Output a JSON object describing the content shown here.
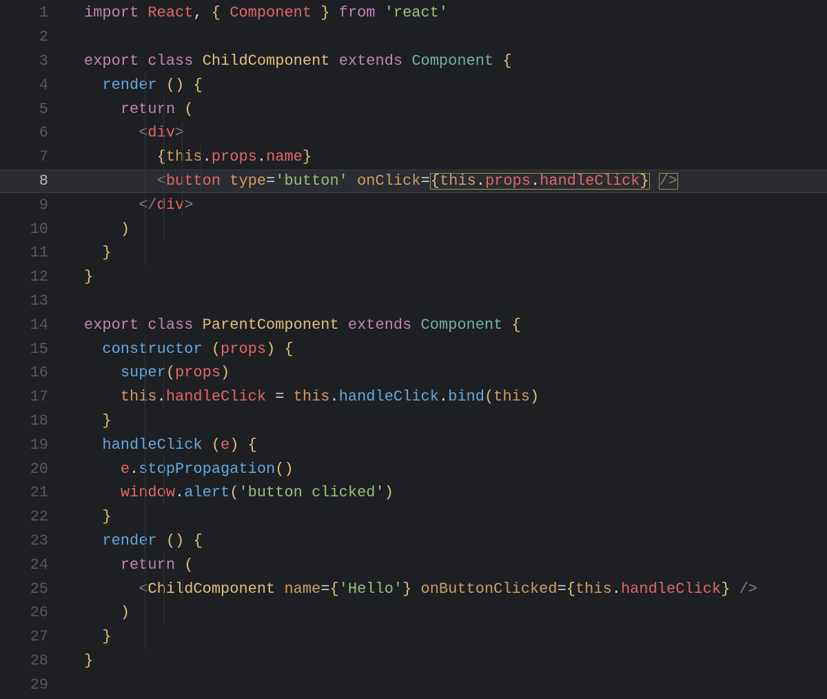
{
  "editor": {
    "highlighted_line": 8,
    "lines": [
      {
        "num": 1,
        "guides": 0,
        "indent": 0,
        "tokens": [
          {
            "c": "kw",
            "t": "import"
          },
          {
            "c": "white",
            "t": " "
          },
          {
            "c": "prop",
            "t": "React"
          },
          {
            "c": "white",
            "t": ", "
          },
          {
            "c": "brace",
            "t": "{"
          },
          {
            "c": "white",
            "t": " "
          },
          {
            "c": "prop",
            "t": "Component"
          },
          {
            "c": "white",
            "t": " "
          },
          {
            "c": "brace",
            "t": "}"
          },
          {
            "c": "white",
            "t": " "
          },
          {
            "c": "kw",
            "t": "from"
          },
          {
            "c": "white",
            "t": " "
          },
          {
            "c": "str",
            "t": "'react'"
          }
        ]
      },
      {
        "num": 2,
        "guides": 0,
        "indent": 0,
        "tokens": []
      },
      {
        "num": 3,
        "guides": 0,
        "indent": 0,
        "tokens": [
          {
            "c": "kw",
            "t": "export"
          },
          {
            "c": "white",
            "t": " "
          },
          {
            "c": "kw",
            "t": "class"
          },
          {
            "c": "white",
            "t": " "
          },
          {
            "c": "cls",
            "t": "ChildComponent"
          },
          {
            "c": "white",
            "t": " "
          },
          {
            "c": "kw",
            "t": "extends"
          },
          {
            "c": "white",
            "t": " "
          },
          {
            "c": "cmp",
            "t": "Component"
          },
          {
            "c": "white",
            "t": " "
          },
          {
            "c": "brace",
            "t": "{"
          }
        ]
      },
      {
        "num": 4,
        "guides": 1,
        "indent": 1,
        "tokens": [
          {
            "c": "mblue",
            "t": "render"
          },
          {
            "c": "white",
            "t": " "
          },
          {
            "c": "brace",
            "t": "()"
          },
          {
            "c": "white",
            "t": " "
          },
          {
            "c": "brace",
            "t": "{"
          }
        ]
      },
      {
        "num": 5,
        "guides": 2,
        "indent": 2,
        "tokens": [
          {
            "c": "kw",
            "t": "return"
          },
          {
            "c": "white",
            "t": " "
          },
          {
            "c": "brace",
            "t": "("
          }
        ]
      },
      {
        "num": 6,
        "guides": 3,
        "indent": 3,
        "tokens": [
          {
            "c": "tagb",
            "t": "<"
          },
          {
            "c": "tagn",
            "t": "div"
          },
          {
            "c": "tagb",
            "t": ">"
          }
        ]
      },
      {
        "num": 7,
        "guides": 4,
        "indent": 4,
        "tokens": [
          {
            "c": "brace",
            "t": "{"
          },
          {
            "c": "thiskw",
            "t": "this"
          },
          {
            "c": "white",
            "t": "."
          },
          {
            "c": "prop",
            "t": "props"
          },
          {
            "c": "white",
            "t": "."
          },
          {
            "c": "prop",
            "t": "name"
          },
          {
            "c": "brace",
            "t": "}"
          }
        ]
      },
      {
        "num": 8,
        "guides": 4,
        "indent": 4,
        "highlighted": true,
        "tokens": [
          {
            "c": "tagb",
            "t": "<"
          },
          {
            "c": "tagn",
            "t": "button"
          },
          {
            "c": "white",
            "t": " "
          },
          {
            "c": "attr",
            "t": "type"
          },
          {
            "c": "white",
            "t": "="
          },
          {
            "c": "str",
            "t": "'button'"
          },
          {
            "c": "white",
            "t": " "
          },
          {
            "c": "attr",
            "t": "onClick"
          },
          {
            "c": "white",
            "t": "="
          },
          {
            "c": "brace",
            "t": "{",
            "box_start": true
          },
          {
            "c": "thiskw",
            "t": "this"
          },
          {
            "c": "white",
            "t": "."
          },
          {
            "c": "prop",
            "t": "props"
          },
          {
            "c": "white",
            "t": "."
          },
          {
            "c": "prop",
            "t": "handleClick"
          },
          {
            "c": "brace",
            "t": "}",
            "box_end": true
          },
          {
            "c": "white",
            "t": " "
          },
          {
            "c": "tagb",
            "t": "/>",
            "box_trail": true
          }
        ]
      },
      {
        "num": 9,
        "guides": 3,
        "indent": 3,
        "tokens": [
          {
            "c": "tagb",
            "t": "</"
          },
          {
            "c": "tagn",
            "t": "div"
          },
          {
            "c": "tagb",
            "t": ">"
          }
        ]
      },
      {
        "num": 10,
        "guides": 2,
        "indent": 2,
        "tokens": [
          {
            "c": "brace",
            "t": ")"
          }
        ]
      },
      {
        "num": 11,
        "guides": 1,
        "indent": 1,
        "tokens": [
          {
            "c": "brace",
            "t": "}"
          }
        ]
      },
      {
        "num": 12,
        "guides": 0,
        "indent": 0,
        "tokens": [
          {
            "c": "brace",
            "t": "}"
          }
        ]
      },
      {
        "num": 13,
        "guides": 0,
        "indent": 0,
        "tokens": []
      },
      {
        "num": 14,
        "guides": 0,
        "indent": 0,
        "tokens": [
          {
            "c": "kw",
            "t": "export"
          },
          {
            "c": "white",
            "t": " "
          },
          {
            "c": "kw",
            "t": "class"
          },
          {
            "c": "white",
            "t": " "
          },
          {
            "c": "cls",
            "t": "ParentComponent"
          },
          {
            "c": "white",
            "t": " "
          },
          {
            "c": "kw",
            "t": "extends"
          },
          {
            "c": "white",
            "t": " "
          },
          {
            "c": "cmp",
            "t": "Component"
          },
          {
            "c": "white",
            "t": " "
          },
          {
            "c": "brace",
            "t": "{"
          }
        ]
      },
      {
        "num": 15,
        "guides": 1,
        "indent": 1,
        "tokens": [
          {
            "c": "mblue",
            "t": "constructor"
          },
          {
            "c": "white",
            "t": " "
          },
          {
            "c": "brace",
            "t": "("
          },
          {
            "c": "prop",
            "t": "props"
          },
          {
            "c": "brace",
            "t": ")"
          },
          {
            "c": "white",
            "t": " "
          },
          {
            "c": "brace",
            "t": "{"
          }
        ]
      },
      {
        "num": 16,
        "guides": 2,
        "indent": 2,
        "tokens": [
          {
            "c": "mblue",
            "t": "super"
          },
          {
            "c": "brace",
            "t": "("
          },
          {
            "c": "prop",
            "t": "props"
          },
          {
            "c": "brace",
            "t": ")"
          }
        ]
      },
      {
        "num": 17,
        "guides": 2,
        "indent": 2,
        "tokens": [
          {
            "c": "thiskw",
            "t": "this"
          },
          {
            "c": "white",
            "t": "."
          },
          {
            "c": "prop",
            "t": "handleClick"
          },
          {
            "c": "white",
            "t": " "
          },
          {
            "c": "white",
            "t": "="
          },
          {
            "c": "white",
            "t": " "
          },
          {
            "c": "thiskw",
            "t": "this"
          },
          {
            "c": "white",
            "t": "."
          },
          {
            "c": "mblue",
            "t": "handleClick"
          },
          {
            "c": "white",
            "t": "."
          },
          {
            "c": "mblue",
            "t": "bind"
          },
          {
            "c": "brace",
            "t": "("
          },
          {
            "c": "thiskw",
            "t": "this"
          },
          {
            "c": "brace",
            "t": ")"
          }
        ]
      },
      {
        "num": 18,
        "guides": 1,
        "indent": 1,
        "tokens": [
          {
            "c": "brace",
            "t": "}"
          }
        ]
      },
      {
        "num": 19,
        "guides": 1,
        "indent": 1,
        "tokens": [
          {
            "c": "mblue",
            "t": "handleClick"
          },
          {
            "c": "white",
            "t": " "
          },
          {
            "c": "brace",
            "t": "("
          },
          {
            "c": "prop",
            "t": "e"
          },
          {
            "c": "brace",
            "t": ")"
          },
          {
            "c": "white",
            "t": " "
          },
          {
            "c": "brace",
            "t": "{"
          }
        ]
      },
      {
        "num": 20,
        "guides": 2,
        "indent": 2,
        "tokens": [
          {
            "c": "prop",
            "t": "e"
          },
          {
            "c": "white",
            "t": "."
          },
          {
            "c": "mblue",
            "t": "stopPropagation"
          },
          {
            "c": "brace",
            "t": "()"
          }
        ]
      },
      {
        "num": 21,
        "guides": 2,
        "indent": 2,
        "tokens": [
          {
            "c": "prop",
            "t": "window"
          },
          {
            "c": "white",
            "t": "."
          },
          {
            "c": "mblue",
            "t": "alert"
          },
          {
            "c": "brace",
            "t": "("
          },
          {
            "c": "str",
            "t": "'button clicked'"
          },
          {
            "c": "brace",
            "t": ")"
          }
        ]
      },
      {
        "num": 22,
        "guides": 1,
        "indent": 1,
        "tokens": [
          {
            "c": "brace",
            "t": "}"
          }
        ]
      },
      {
        "num": 23,
        "guides": 1,
        "indent": 1,
        "tokens": [
          {
            "c": "mblue",
            "t": "render"
          },
          {
            "c": "white",
            "t": " "
          },
          {
            "c": "brace",
            "t": "()"
          },
          {
            "c": "white",
            "t": " "
          },
          {
            "c": "brace",
            "t": "{"
          }
        ]
      },
      {
        "num": 24,
        "guides": 2,
        "indent": 2,
        "tokens": [
          {
            "c": "kw",
            "t": "return"
          },
          {
            "c": "white",
            "t": " "
          },
          {
            "c": "brace",
            "t": "("
          }
        ]
      },
      {
        "num": 25,
        "guides": 3,
        "indent": 3,
        "tokens": [
          {
            "c": "tagb",
            "t": "<"
          },
          {
            "c": "cls",
            "t": "ChildComponent"
          },
          {
            "c": "white",
            "t": " "
          },
          {
            "c": "attr",
            "t": "name"
          },
          {
            "c": "white",
            "t": "="
          },
          {
            "c": "brace",
            "t": "{"
          },
          {
            "c": "str",
            "t": "'Hello'"
          },
          {
            "c": "brace",
            "t": "}"
          },
          {
            "c": "white",
            "t": " "
          },
          {
            "c": "attr",
            "t": "onButtonClicked"
          },
          {
            "c": "white",
            "t": "="
          },
          {
            "c": "brace",
            "t": "{"
          },
          {
            "c": "thiskw",
            "t": "this"
          },
          {
            "c": "white",
            "t": "."
          },
          {
            "c": "prop",
            "t": "handleClick"
          },
          {
            "c": "brace",
            "t": "}"
          },
          {
            "c": "white",
            "t": " "
          },
          {
            "c": "tagb",
            "t": "/>"
          }
        ]
      },
      {
        "num": 26,
        "guides": 2,
        "indent": 2,
        "tokens": [
          {
            "c": "brace",
            "t": ")"
          }
        ]
      },
      {
        "num": 27,
        "guides": 1,
        "indent": 1,
        "tokens": [
          {
            "c": "brace",
            "t": "}"
          }
        ]
      },
      {
        "num": 28,
        "guides": 0,
        "indent": 0,
        "tokens": [
          {
            "c": "brace",
            "t": "}"
          }
        ]
      },
      {
        "num": 29,
        "guides": 0,
        "indent": 0,
        "tokens": []
      }
    ]
  }
}
